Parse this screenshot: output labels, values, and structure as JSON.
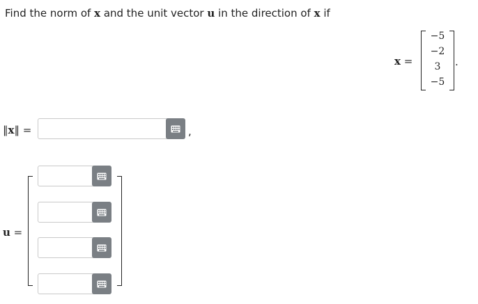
{
  "prompt": {
    "part1": "Find the norm of ",
    "x1": "x",
    "part2": " and the unit vector ",
    "u": "u",
    "part3": " in the direction of ",
    "x2": "x",
    "part4": " if"
  },
  "given": {
    "label_var": "x",
    "label_eq": " =",
    "entries": [
      "−5",
      "−2",
      "3",
      "−5"
    ],
    "period": "."
  },
  "norm": {
    "label_left": "‖",
    "label_var": "x",
    "label_right": "‖ =",
    "value": "",
    "trailing": ","
  },
  "unit_vector": {
    "label_var": "u",
    "label_eq": " =",
    "inputs": [
      "",
      "",
      "",
      ""
    ]
  },
  "icons": {
    "keyboard": "keyboard-icon"
  },
  "colors": {
    "button_bg": "#7a7f84",
    "input_border": "#c9c9c9"
  }
}
